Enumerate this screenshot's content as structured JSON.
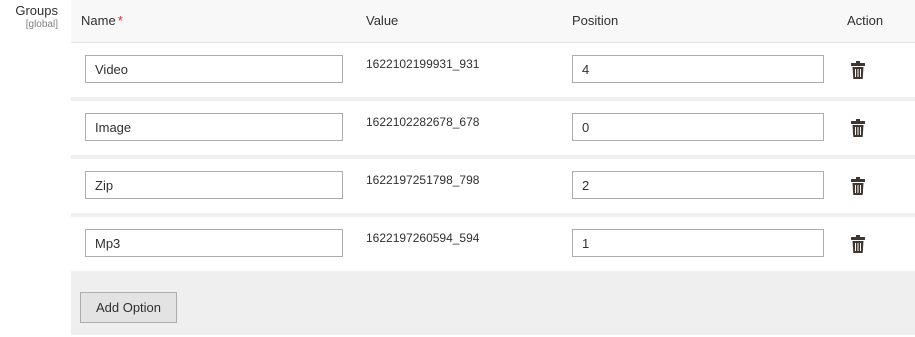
{
  "field": {
    "label": "Groups",
    "scope": "[global]"
  },
  "table": {
    "headers": {
      "name": "Name",
      "required_marker": "*",
      "value": "Value",
      "position": "Position",
      "action": "Action"
    },
    "rows": [
      {
        "name": "Video",
        "value": "1622102199931_931",
        "position": "4"
      },
      {
        "name": "Image",
        "value": "1622102282678_678",
        "position": "0"
      },
      {
        "name": "Zip",
        "value": "1622197251798_798",
        "position": "2"
      },
      {
        "name": "Mp3",
        "value": "1622197260594_594",
        "position": "1"
      }
    ],
    "delete_icon": "trash-icon",
    "add_option_label": "Add Option"
  },
  "colors": {
    "header_bg": "#f8f8f8",
    "table_bg": "#efefef",
    "row_bg": "#ffffff",
    "required": "#e22626",
    "button_bg": "#e3e3e3",
    "input_border": "#adadad"
  }
}
